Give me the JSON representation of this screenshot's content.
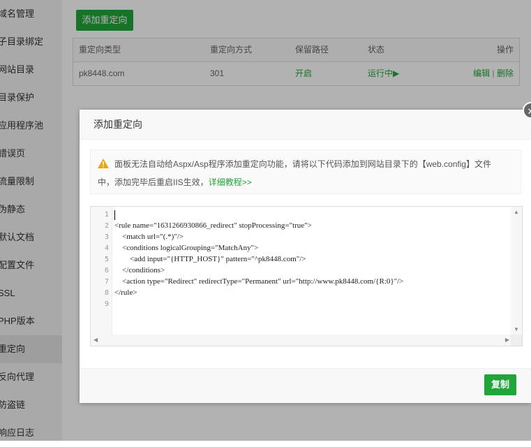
{
  "sidebar": {
    "items": [
      {
        "label": "域名管理"
      },
      {
        "label": "子目录绑定"
      },
      {
        "label": "网站目录"
      },
      {
        "label": "目录保护"
      },
      {
        "label": "应用程序池"
      },
      {
        "label": "错误页"
      },
      {
        "label": "流量限制"
      },
      {
        "label": "伪静态"
      },
      {
        "label": "默认文档"
      },
      {
        "label": "配置文件"
      },
      {
        "label": "SSL"
      },
      {
        "label": "PHP版本"
      },
      {
        "label": "重定向",
        "active": true
      },
      {
        "label": "反向代理"
      },
      {
        "label": "防盗链"
      },
      {
        "label": "响应日志"
      }
    ]
  },
  "main": {
    "add_button": "添加重定向",
    "table": {
      "headers": [
        "重定向类型",
        "重定向方式",
        "保留路径",
        "状态",
        "操作"
      ],
      "rows": [
        {
          "type": "pk8448.com",
          "method": "301",
          "keep_path": "开启",
          "status": "运行中▶",
          "edit": "编辑",
          "sep": "|",
          "delete": "删除"
        }
      ]
    }
  },
  "modal": {
    "title": "添加重定向",
    "close_icon": "close-icon",
    "notice": {
      "icon": "warning-icon",
      "line1": "面板无法自动给Aspx/Asp程序添加重定向功能，请将以下代码添加到网站目录下的【web.config】文件",
      "line2": "中，添加完毕后重启IIS生效，",
      "link": "详细教程>>"
    },
    "editor": {
      "line_numbers": [
        "1",
        "2",
        "3",
        "4",
        "5",
        "6",
        "7",
        "8",
        "9"
      ],
      "lines": [
        "",
        "<rule name=\"1631266930866_redirect\" stopProcessing=\"true\">",
        "    <match url=\"(.*)\"/>",
        "    <conditions logicalGrouping=\"MatchAny\">",
        "        <add input=\"{HTTP_HOST}\" pattern=\"^pk8448.com\"/>",
        "    </conditions>",
        "    <action type=\"Redirect\" redirectType=\"Permanent\" url=\"http://www.pk8448.com/{R:0}\"/>",
        "</rule>",
        ""
      ]
    },
    "copy_button": "复制"
  },
  "colors": {
    "accent": "#20a53a",
    "warning": "#f0a30a"
  }
}
